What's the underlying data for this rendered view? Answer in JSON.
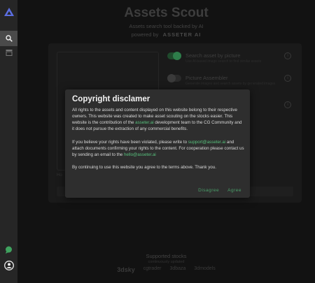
{
  "app": {
    "title": "Assets Scout",
    "subtitle": "Assets search tool backed by AI",
    "powered_by": "powered by",
    "brand": "ASSETER AI"
  },
  "search_card": {
    "options": [
      {
        "label": "Search asset by picture",
        "description": "Use AI-based image search to find similar assets",
        "enabled": true
      },
      {
        "label": "Picture Assembler",
        "description": "Generate images and search assets by generated images",
        "enabled": false
      },
      {
        "label": "",
        "description": "",
        "enabled": false
      }
    ],
    "drop_hint": "",
    "hint_prefix": "Ho"
  },
  "footer": {
    "title": "Supported stocks",
    "subtitle": "continuously updated",
    "stocks": [
      "3dsky",
      "cgtrader",
      "3dbaza",
      "3dmodels"
    ]
  },
  "modal": {
    "title": "Copyright disclamer",
    "p1": "All rights to the assets and content displayed on this website belong to their respective owners. This website was created to make asset scouting on the stocks easier. This website is the contribution of the ",
    "p1_link": "asseter.ai",
    "p1_end": " development team to the CG Community and it does not pursue the extraction of any commercial benefits.",
    "p2_start": "If you believe your rights have been violated, please write to ",
    "p2_link1": "support@asseter.ai",
    "p2_mid": " and attach documents confirming your rights to the content. For cooperation please contact us by sending an email to the ",
    "p2_link2": "hello@asseter.ai",
    "p3": "By continuing to use this website you agree to the terms above. Thank you.",
    "disagree": "Disagree",
    "agree": "Agree"
  },
  "colors": {
    "accent": "#58c17d",
    "sidebar_logo": "#5b6ee1"
  }
}
